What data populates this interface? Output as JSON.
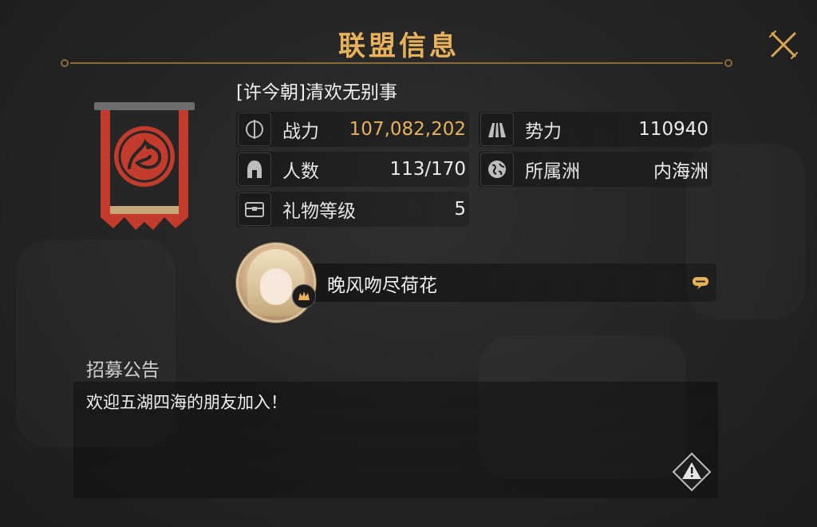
{
  "header": {
    "title": "联盟信息"
  },
  "guild": {
    "name": "[许今朝]清欢无别事"
  },
  "stats": {
    "power": {
      "label": "战力",
      "value": "107,082,202",
      "icon": "power-icon",
      "color": "#e8b25a"
    },
    "influence": {
      "label": "势力",
      "value": "110940",
      "icon": "influence-icon"
    },
    "members": {
      "label": "人数",
      "value": "113/170",
      "icon": "helmet-icon"
    },
    "region": {
      "label": "所属洲",
      "value": "内海洲",
      "icon": "globe-icon"
    },
    "gift_level": {
      "label": "礼物等级",
      "value": "5",
      "icon": "chest-icon"
    }
  },
  "leader": {
    "name": "晚风吻尽荷花",
    "chat_icon": "chat-icon"
  },
  "recruit": {
    "title": "招募公告",
    "text": "欢迎五湖四海的朋友加入！",
    "report_icon": "warning-icon"
  },
  "colors": {
    "accent": "#e8b25a",
    "banner_red": "#c0392b",
    "banner_dark": "#2a2a2a"
  }
}
